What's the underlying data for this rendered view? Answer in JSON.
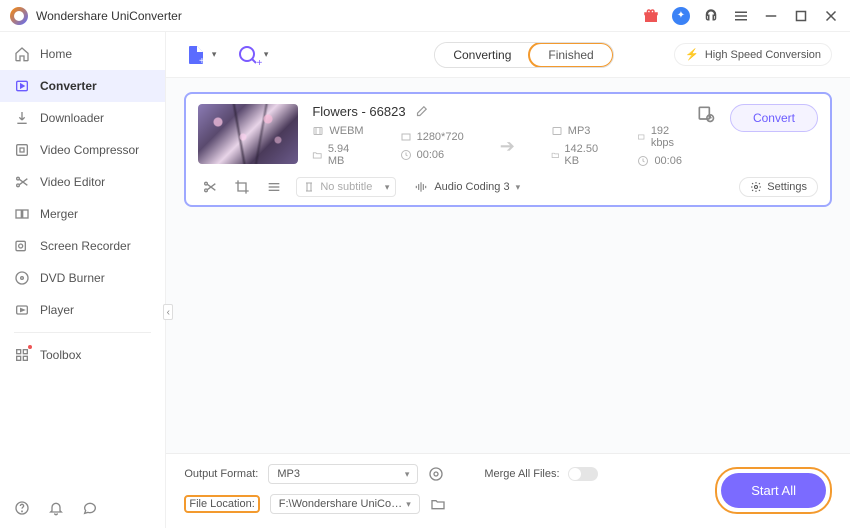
{
  "app": {
    "title": "Wondershare UniConverter"
  },
  "sidebar": {
    "items": [
      {
        "label": "Home"
      },
      {
        "label": "Converter"
      },
      {
        "label": "Downloader"
      },
      {
        "label": "Video Compressor"
      },
      {
        "label": "Video Editor"
      },
      {
        "label": "Merger"
      },
      {
        "label": "Screen Recorder"
      },
      {
        "label": "DVD Burner"
      },
      {
        "label": "Player"
      },
      {
        "label": "Toolbox"
      }
    ]
  },
  "toolbar": {
    "converting_label": "Converting",
    "finished_label": "Finished",
    "speed_label": "High Speed Conversion"
  },
  "file": {
    "title": "Flowers - 66823",
    "src": {
      "format": "WEBM",
      "resolution": "1280*720",
      "size": "5.94 MB",
      "duration": "00:06"
    },
    "dst": {
      "format": "MP3",
      "bitrate": "192 kbps",
      "size": "142.50 KB",
      "duration": "00:06"
    },
    "convert_label": "Convert",
    "subtitle_placeholder": "No subtitle",
    "audio_label": "Audio Coding 3",
    "settings_label": "Settings"
  },
  "footer": {
    "output_format_label": "Output Format:",
    "output_format_value": "MP3",
    "file_location_label": "File Location:",
    "file_location_value": "F:\\Wondershare UniConverter",
    "merge_label": "Merge All Files:",
    "start_all_label": "Start All"
  }
}
